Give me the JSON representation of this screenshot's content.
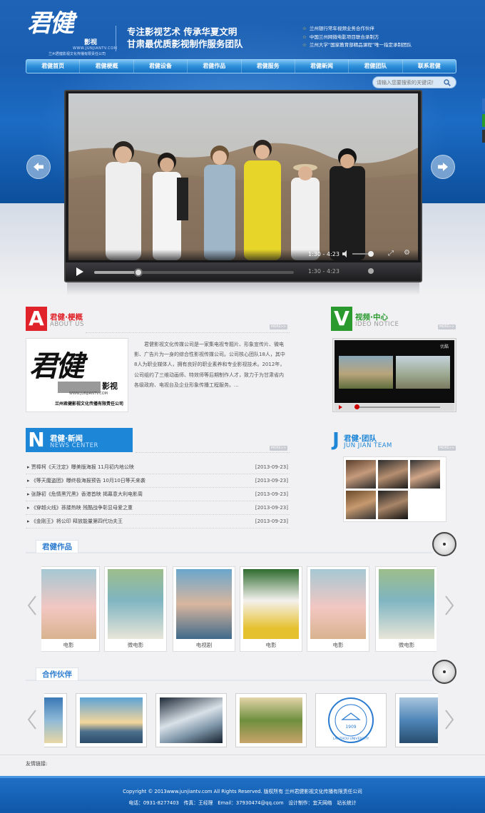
{
  "header": {
    "logo_mark": "君健",
    "logo_sub": "影视",
    "logo_web": "WWW.JUNJIANTV.COM",
    "logo_company": "兰州君健影视文化传播有限责任公司",
    "slogan_line1": "专注影视艺术 传承华夏文明",
    "slogan_line2": "甘肃最优质影视制作服务团队",
    "news": [
      "兰州银行常年视频业务合作伙伴",
      "中国兰州网微电影项目联合承制方",
      "兰州大学“国家教育部精品课程”唯一指定承制团队"
    ]
  },
  "nav": [
    "君健首页",
    "君健梗概",
    "君健设备",
    "君健作品",
    "君健服务",
    "君健新闻",
    "君健团队",
    "联系君健"
  ],
  "search": {
    "placeholder": "请输入您要搜索的关键词！"
  },
  "player": {
    "time_current": "1:30",
    "time_sep": " - ",
    "time_total": "4:23",
    "progress": 0.22
  },
  "about": {
    "letter": "A",
    "title": "君健·梗概",
    "en": "ABOUT US",
    "more": "MORE>>",
    "text": "君健影视文化传媒公司是一家集电视专题片、形象宣传片、微电影、广告片为一身的综合性影视传媒公司。公司核心团队18人，其中8人为职业媒体人，拥有良好的职业素养和专业影视技术。2012年，公司组约了三维动画师、特效师等后期制作人才，致力于为甘肃省内各级政府、电视台及企业形象传播工程服务。..."
  },
  "video": {
    "letter": "V",
    "title": "视频·中心",
    "en": "IDEO NOTICE",
    "more": "MORE>>",
    "tag": "优酷"
  },
  "news": {
    "letter": "N",
    "title": "君健·新闻",
    "en": "NEWS CENTER",
    "more": "MORE>>",
    "items": [
      {
        "title": "贾樟柯《天注定》曝美版海报 11月初内地公映",
        "date": "[2013-09-23]"
      },
      {
        "title": "《等天魔盗团》曝终极海报预告 10月10日等天来袭",
        "date": "[2013-09-23]"
      },
      {
        "title": "张静初《危情黑咒黑》香港首映 揭幕意大利电影周",
        "date": "[2013-09-23]"
      },
      {
        "title": "《穿越火线》孫搂热映 残酷战争彰显母爱之重",
        "date": "[2013-09-23]"
      },
      {
        "title": "《金刚王》将公印 释放能量第四代功夫王",
        "date": "[2013-09-23]"
      }
    ]
  },
  "team": {
    "letter": "J",
    "title": "君健·团队",
    "en": "JUN JIAN TEAM",
    "more": "MORE>>"
  },
  "works": {
    "title": "君健作品",
    "items": [
      "电影",
      "微电影",
      "电视剧",
      "电影",
      "电影",
      "微电影"
    ]
  },
  "partners": {
    "title": "合作伙伴",
    "lanzhou_year": "1909",
    "lanzhou_en": "LANZHOU UNIVERSITY"
  },
  "links": {
    "label": "友情链接:"
  },
  "footer": {
    "line1": "Copyright © 2013www.junjiantv.com All Rights Reserved. 版权所有 兰州君健影视文化传播有限责任公司",
    "line2": "电话：0931-8277403　传真：王经理　Email：37930474@qq.com　设计制作：宜天网络　站长统计"
  },
  "colors": {
    "brand_blue": "#1a5eb1",
    "red": "#e0232a",
    "green": "#2a9a2e",
    "blue": "#1e86d6"
  }
}
